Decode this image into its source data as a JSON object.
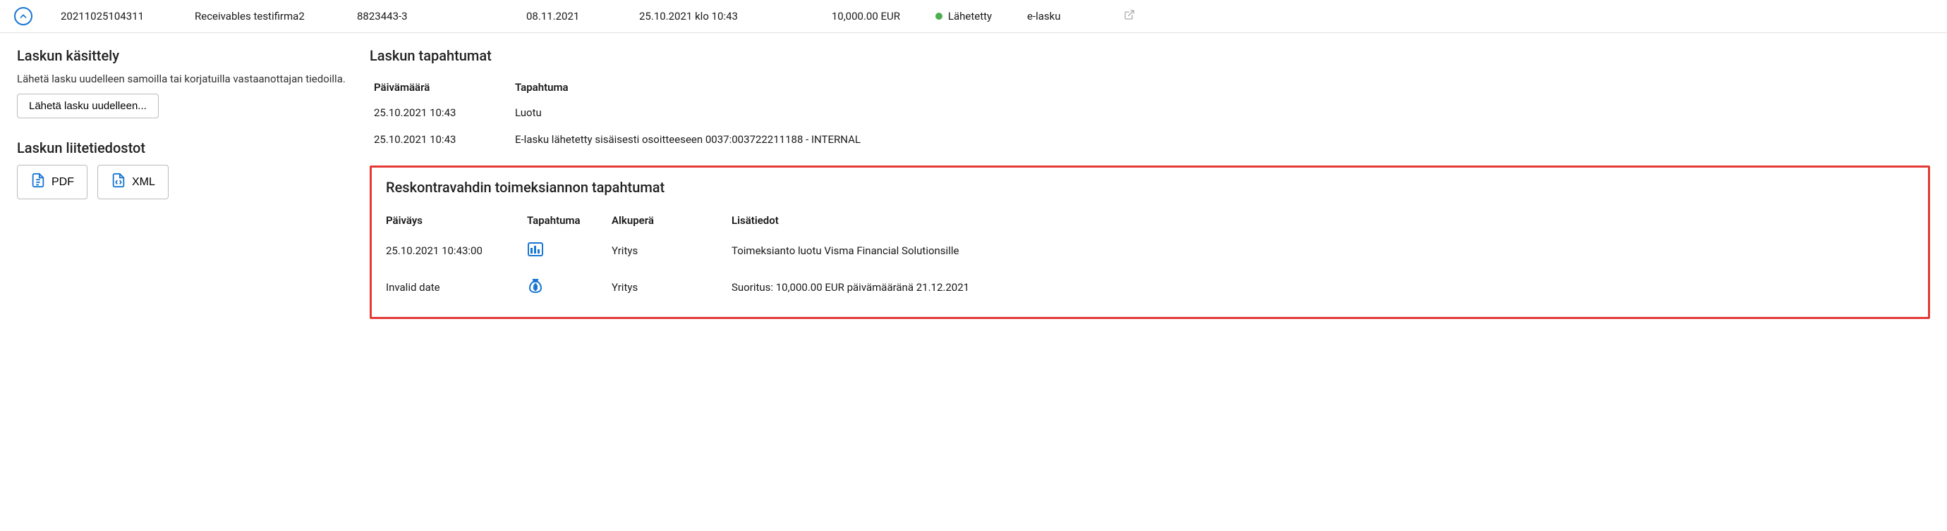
{
  "row": {
    "id": "20211025104311",
    "name": "Receivables testifirma2",
    "ref": "8823443-3",
    "date1": "08.11.2021",
    "date2": "25.10.2021 klo 10:43",
    "amount": "10,000.00  EUR",
    "status": "Lähetetty",
    "status_color": "#4caf50",
    "type": "e-lasku"
  },
  "processing": {
    "title": "Laskun käsittely",
    "desc": "Lähetä lasku uudelleen samoilla tai korjatuilla vastaanottajan tiedoilla.",
    "btn": "Lähetä lasku uudelleen..."
  },
  "attachments": {
    "title": "Laskun liitetiedostot",
    "pdf": "PDF",
    "xml": "XML"
  },
  "events": {
    "title": "Laskun tapahtumat",
    "head_date": "Päivämäärä",
    "head_event": "Tapahtuma",
    "rows": [
      {
        "date": "25.10.2021 10:43",
        "event": "Luotu"
      },
      {
        "date": "25.10.2021 10:43",
        "event": "E-lasku lähetetty sisäisesti osoitteeseen 0037:003722211188 - INTERNAL"
      }
    ]
  },
  "reskontra": {
    "title": "Reskontravahdin toimeksiannon tapahtumat",
    "head_date": "Päiväys",
    "head_event": "Tapahtuma",
    "head_origin": "Alkuperä",
    "head_info": "Lisätiedot",
    "rows": [
      {
        "date": "25.10.2021 10:43:00",
        "icon": "report",
        "origin": "Yritys",
        "info": "Toimeksianto luotu Visma Financial Solutionsille"
      },
      {
        "date": "Invalid date",
        "icon": "moneybag",
        "origin": "Yritys",
        "info": "Suoritus: 10,000.00 EUR päivämääränä 21.12.2021"
      }
    ]
  }
}
